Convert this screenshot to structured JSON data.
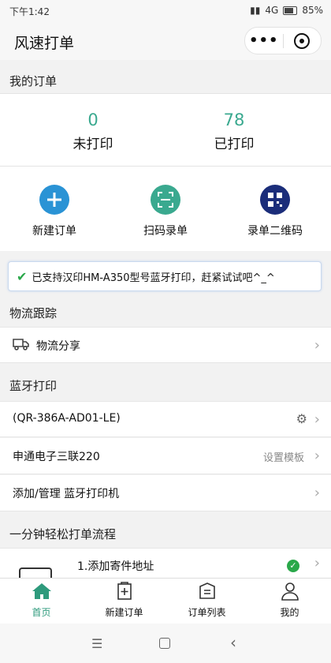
{
  "status": {
    "time": "下午1:42",
    "network": "4G",
    "battery": "85%"
  },
  "navbar": {
    "title": "风速打单",
    "more": "•••"
  },
  "orders": {
    "header": "我的订单",
    "stats": [
      {
        "value": "0",
        "label": "未打印"
      },
      {
        "value": "78",
        "label": "已打印"
      }
    ],
    "actions": [
      {
        "label": "新建订单",
        "icon": "plus-icon",
        "color": "#2a93d5"
      },
      {
        "label": "扫码录单",
        "icon": "scan-icon",
        "color": "#3aa98f"
      },
      {
        "label": "录单二维码",
        "icon": "qrcode-icon",
        "color": "#1b2d7a"
      }
    ]
  },
  "notice": {
    "text": "已支持汉印HM-A350型号蓝牙打印，赶紧试试吧^_^"
  },
  "logistics": {
    "header": "物流跟踪",
    "share_label": "物流分享"
  },
  "bluetooth": {
    "header": "蓝牙打印",
    "device": "(QR-386A-AD01-LE)",
    "template_name": "申通电子三联220",
    "template_action": "设置模板",
    "manage_label": "添加/管理 蓝牙打印机"
  },
  "flow": {
    "header": "一分钟轻松打单流程",
    "step1": "1.添加寄件地址"
  },
  "tabs": [
    {
      "label": "首页",
      "icon": "home-icon"
    },
    {
      "label": "新建订单",
      "icon": "new-order-icon"
    },
    {
      "label": "订单列表",
      "icon": "order-list-icon"
    },
    {
      "label": "我的",
      "icon": "user-icon"
    }
  ],
  "colors": {
    "accent": "#3aa98f",
    "active_tab": "#2e9a7c"
  }
}
